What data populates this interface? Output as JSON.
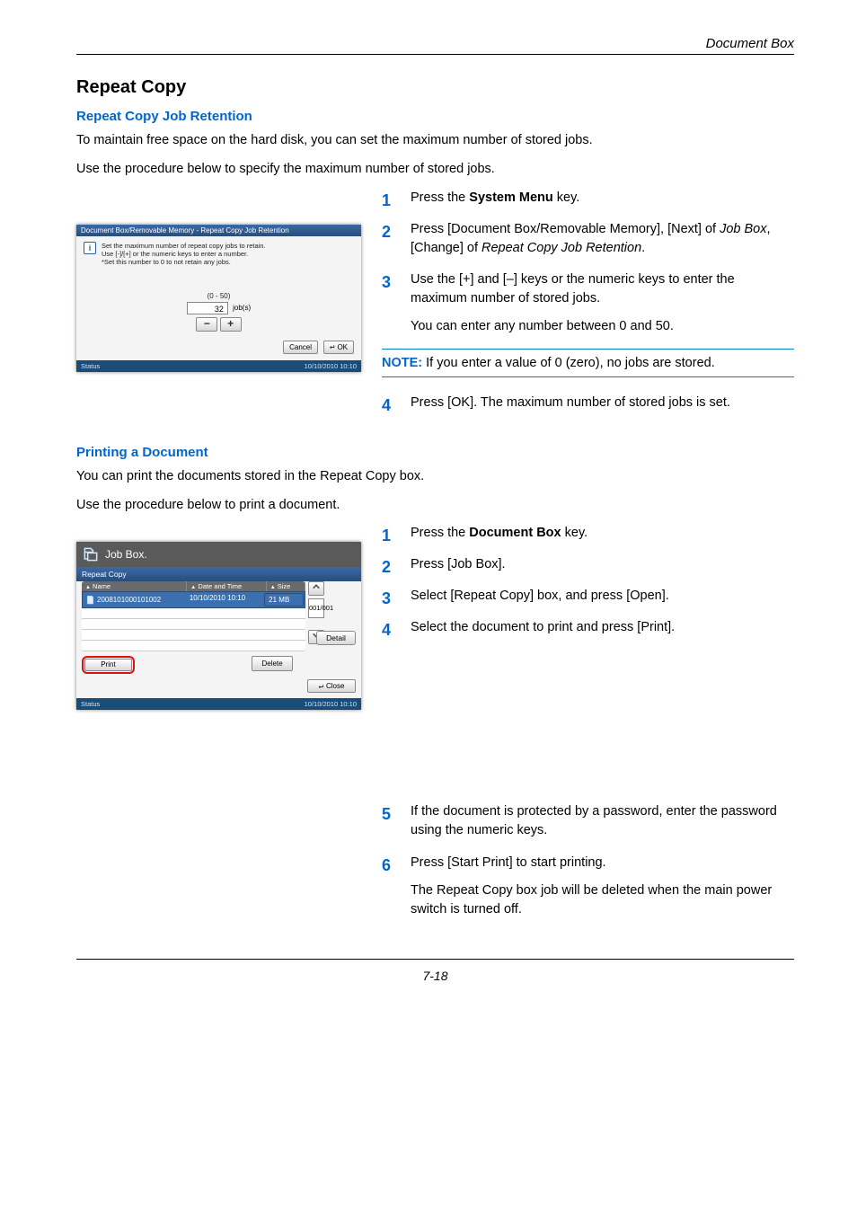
{
  "header_right": "Document Box",
  "h2": "Repeat Copy",
  "sub1": "Repeat Copy Job Retention",
  "intro1a": "To maintain free space on the hard disk, you can set the maximum number of stored jobs.",
  "intro1b": "Use the procedure below to specify the maximum number of stored jobs.",
  "steps1": {
    "s1a": "Press the ",
    "s1b": "System Menu",
    "s1c": " key.",
    "s2a": "Press [Document Box/Removable Memory], [Next] of ",
    "s2b": "Job Box",
    "s2c": ", [Change] of ",
    "s2d": "Repeat Copy Job Retention",
    "s2e": ".",
    "s3a": "Use the [+] and [–] keys or the numeric keys  to enter the maximum number of stored jobs.",
    "s3b": "You can enter any number between 0 and 50.",
    "s4": "Press [OK]. The maximum number of stored jobs is set."
  },
  "note_label": "NOTE:",
  "note_text": " If you enter a value of 0 (zero), no jobs are stored.",
  "panel1": {
    "title": "Document Box/Removable Memory - Repeat Copy Job Retention",
    "info1": "Set the maximum number of repeat copy jobs to retain.",
    "info2": "Use [-]/[+] or the numeric keys to enter a number.",
    "info3": "*Set this number to 0 to not retain any jobs.",
    "range": "(0 - 50)",
    "value": "32",
    "unit": "job(s)",
    "cancel": "Cancel",
    "ok": "OK",
    "status": "Status",
    "datetime": "10/10/2010   10:10"
  },
  "sub2": "Printing a Document",
  "intro2a": "You can print the documents stored in the Repeat Copy box.",
  "intro2b": "Use the procedure below to print a document.",
  "steps2": {
    "s1a": "Press the ",
    "s1b": "Document Box",
    "s1c": " key.",
    "s2": "Press [Job Box].",
    "s3": "Select [Repeat Copy] box, and press [Open].",
    "s4": "Select the document to print and press [Print].",
    "s5": "If the document is protected by a password, enter the password using the numeric keys.",
    "s6a": "Press [Start Print] to start printing.",
    "s6b": "The Repeat Copy box job will be deleted when the main power switch is turned off."
  },
  "panel2": {
    "title": "Job Box.",
    "subtitle": "Repeat Copy",
    "col_name": "Name",
    "col_date": "Date and Time",
    "col_size": "Size",
    "row_name": "2008101000101002",
    "row_date": "10/10/2010  10:10",
    "row_size": "21 MB",
    "counter": "001/001",
    "detail": "Detail",
    "print": "Print",
    "delete": "Delete",
    "close": "Close",
    "status": "Status",
    "datetime": "10/10/2010   10:10"
  },
  "footer": "7-18"
}
